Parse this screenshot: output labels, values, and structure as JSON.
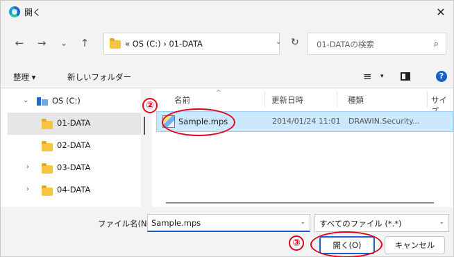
{
  "window": {
    "title": "開く",
    "close_glyph": "✕"
  },
  "nav": {
    "back_glyph": "←",
    "forward_glyph": "→",
    "recent_glyph": "⌄",
    "up_glyph": "↑",
    "address_path": "« OS (C:)  ›  01-DATA",
    "address_dropdown_glyph": "⌄",
    "refresh_glyph": "↻",
    "search_placeholder": "01-DATAの検索",
    "search_glyph": "⌕"
  },
  "toolbar": {
    "organize_label": "整理 ▾",
    "new_folder_label": "新しいフォルダー",
    "view_glyph": "≡",
    "view_dropdown_glyph": "▾",
    "help_glyph": "?"
  },
  "tree": {
    "items": [
      {
        "label": "OS (C:)",
        "chevron": "⌄"
      },
      {
        "label": "01-DATA",
        "chevron": ""
      },
      {
        "label": "02-DATA",
        "chevron": ""
      },
      {
        "label": "03-DATA",
        "chevron": "›"
      },
      {
        "label": "04-DATA",
        "chevron": "›"
      }
    ]
  },
  "columns": {
    "sort_glyph": "^",
    "name": "名前",
    "date": "更新日時",
    "type": "種類",
    "size": "サイズ"
  },
  "files": [
    {
      "name": "Sample.mps",
      "modified": "2014/01/24 11:01",
      "type": "DRAWIN.Security..."
    }
  ],
  "bottom": {
    "filename_label": "ファイル名(N):",
    "filename_value": "Sample.mps",
    "filename_dropdown_glyph": "⌄",
    "filetype_value": "すべてのファイル (*.*)",
    "filetype_dropdown_glyph": "⌄",
    "open_label": "開く(O)",
    "cancel_label": "キャンセル"
  },
  "annotations": {
    "step2": "②",
    "step3": "③",
    "color": "#e0001b"
  },
  "colors": {
    "accent": "#1663c7",
    "selection": "#cce8ff",
    "folder": "#f5c542"
  }
}
